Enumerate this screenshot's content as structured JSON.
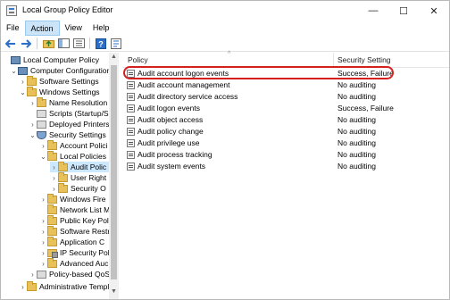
{
  "window": {
    "title": "Local Group Policy Editor"
  },
  "window_controls": {
    "minimize": "—",
    "maximize": "☐",
    "close": "✕"
  },
  "menu": [
    "File",
    "Action",
    "View",
    "Help"
  ],
  "toolbar_icons": [
    "back-arrow-icon",
    "forward-arrow-icon",
    "folder-up-icon",
    "show-hide-tree-icon",
    "export-list-icon",
    "help-icon",
    "properties-icon"
  ],
  "tree": [
    {
      "label": "Local Computer Policy",
      "icon": "computer-icon",
      "expander": ""
    },
    {
      "label": "Computer Configuration",
      "icon": "computer-icon",
      "expander": "⌄"
    },
    {
      "label": "Software Settings",
      "icon": "folder-icon",
      "expander": "›"
    },
    {
      "label": "Windows Settings",
      "icon": "folder-icon",
      "expander": "⌄"
    },
    {
      "label": "Name Resolution",
      "icon": "folder-icon",
      "expander": "›"
    },
    {
      "label": "Scripts (Startup/Sl",
      "icon": "policy-icon",
      "expander": ""
    },
    {
      "label": "Deployed Printers",
      "icon": "policy-icon",
      "expander": "›"
    },
    {
      "label": "Security Settings",
      "icon": "shield-icon",
      "expander": "⌄"
    },
    {
      "label": "Account Polici",
      "icon": "folder-icon",
      "expander": "›"
    },
    {
      "label": "Local Policies",
      "icon": "folder-icon",
      "expander": "⌄"
    },
    {
      "label": "Audit Polic",
      "icon": "folder-icon",
      "expander": "›"
    },
    {
      "label": "User Right",
      "icon": "folder-icon",
      "expander": "›"
    },
    {
      "label": "Security O",
      "icon": "folder-icon",
      "expander": "›"
    },
    {
      "label": "Windows Fire",
      "icon": "folder-icon",
      "expander": "›"
    },
    {
      "label": "Network List M",
      "icon": "folder-icon",
      "expander": ""
    },
    {
      "label": "Public Key Pol",
      "icon": "folder-icon",
      "expander": "›"
    },
    {
      "label": "Software Restri",
      "icon": "folder-icon",
      "expander": "›"
    },
    {
      "label": "Application C",
      "icon": "folder-icon",
      "expander": "›"
    },
    {
      "label": "IP Security Pol",
      "icon": "lock-folder-icon",
      "expander": "›"
    },
    {
      "label": "Advanced Auc",
      "icon": "folder-icon",
      "expander": "›"
    },
    {
      "label": "Policy-based QoS",
      "icon": "chart-icon",
      "expander": "›"
    },
    {
      "label": "Administrative Templ",
      "icon": "folder-icon",
      "expander": "›"
    }
  ],
  "table": {
    "columns": [
      "Policy",
      "Security Setting"
    ],
    "sort_arrow": "^",
    "rows": [
      {
        "policy": "Audit account logon events",
        "setting": "Success, Failure",
        "highlighted": true
      },
      {
        "policy": "Audit account management",
        "setting": "No auditing"
      },
      {
        "policy": "Audit directory service access",
        "setting": "No auditing"
      },
      {
        "policy": "Audit logon events",
        "setting": "Success, Failure"
      },
      {
        "policy": "Audit object access",
        "setting": "No auditing"
      },
      {
        "policy": "Audit policy change",
        "setting": "No auditing"
      },
      {
        "policy": "Audit privilege use",
        "setting": "No auditing"
      },
      {
        "policy": "Audit process tracking",
        "setting": "No auditing"
      },
      {
        "policy": "Audit system events",
        "setting": "No auditing"
      }
    ]
  },
  "colors": {
    "highlight_ring": "#d62020",
    "selection": "#cce8ff",
    "menu_active": "#cce4f7"
  }
}
